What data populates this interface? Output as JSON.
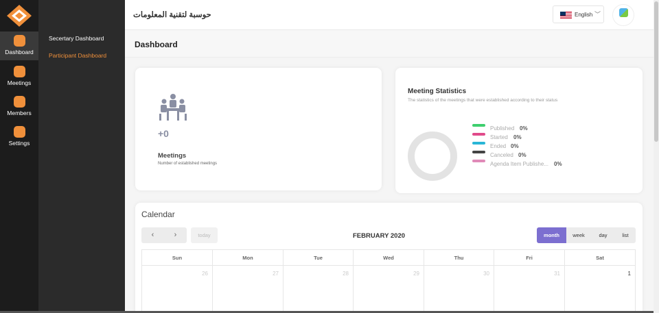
{
  "rail": {
    "items": [
      {
        "label": "Dashboard",
        "icon": "dashboard-icon",
        "active": true
      },
      {
        "label": "Meetings",
        "icon": "meetings-icon",
        "active": false
      },
      {
        "label": "Members",
        "icon": "members-icon",
        "active": false
      },
      {
        "label": "Settings",
        "icon": "settings-icon",
        "active": false
      }
    ]
  },
  "submenu": {
    "items": [
      {
        "label": "Secertary Dashboard",
        "active": false
      },
      {
        "label": "Participant Dashboard",
        "active": true
      }
    ]
  },
  "header": {
    "company": "حوسبة لتقنية المعلومات",
    "language": "English",
    "language_chevron": "﹀"
  },
  "page": {
    "title": "Dashboard"
  },
  "meetings_card": {
    "count": "+0",
    "title": "Meetings",
    "subtitle": "Number of established meetings"
  },
  "stats_card": {
    "title": "Meeting Statistics",
    "subtitle": "The statistics of the meetings that were established according to their status",
    "legend": [
      {
        "label": "Published",
        "value": "0%",
        "color": "#3ecf6e"
      },
      {
        "label": "Started",
        "value": "0%",
        "color": "#e04a8a"
      },
      {
        "label": "Ended",
        "value": "0%",
        "color": "#29b6d6"
      },
      {
        "label": "Canceled",
        "value": "0%",
        "color": "#444444"
      },
      {
        "label": "Agenda Item Publishe...",
        "value": "0%",
        "color": "#e08ab8"
      }
    ]
  },
  "calendar": {
    "title": "Calendar",
    "prev": "‹",
    "next": "›",
    "today": "today",
    "month_label": "FEBRUARY 2020",
    "views": [
      {
        "label": "month",
        "active": true
      },
      {
        "label": "week",
        "active": false
      },
      {
        "label": "day",
        "active": false
      },
      {
        "label": "list",
        "active": false
      }
    ],
    "weekdays": [
      "Sun",
      "Mon",
      "Tue",
      "Wed",
      "Thu",
      "Fri",
      "Sat"
    ],
    "first_row": [
      {
        "day": "26",
        "current": false
      },
      {
        "day": "27",
        "current": false
      },
      {
        "day": "28",
        "current": false
      },
      {
        "day": "29",
        "current": false
      },
      {
        "day": "30",
        "current": false
      },
      {
        "day": "31",
        "current": false
      },
      {
        "day": "1",
        "current": true
      }
    ]
  },
  "colors": {
    "accent": "#f0903b",
    "view_active": "#7c6fd0"
  }
}
